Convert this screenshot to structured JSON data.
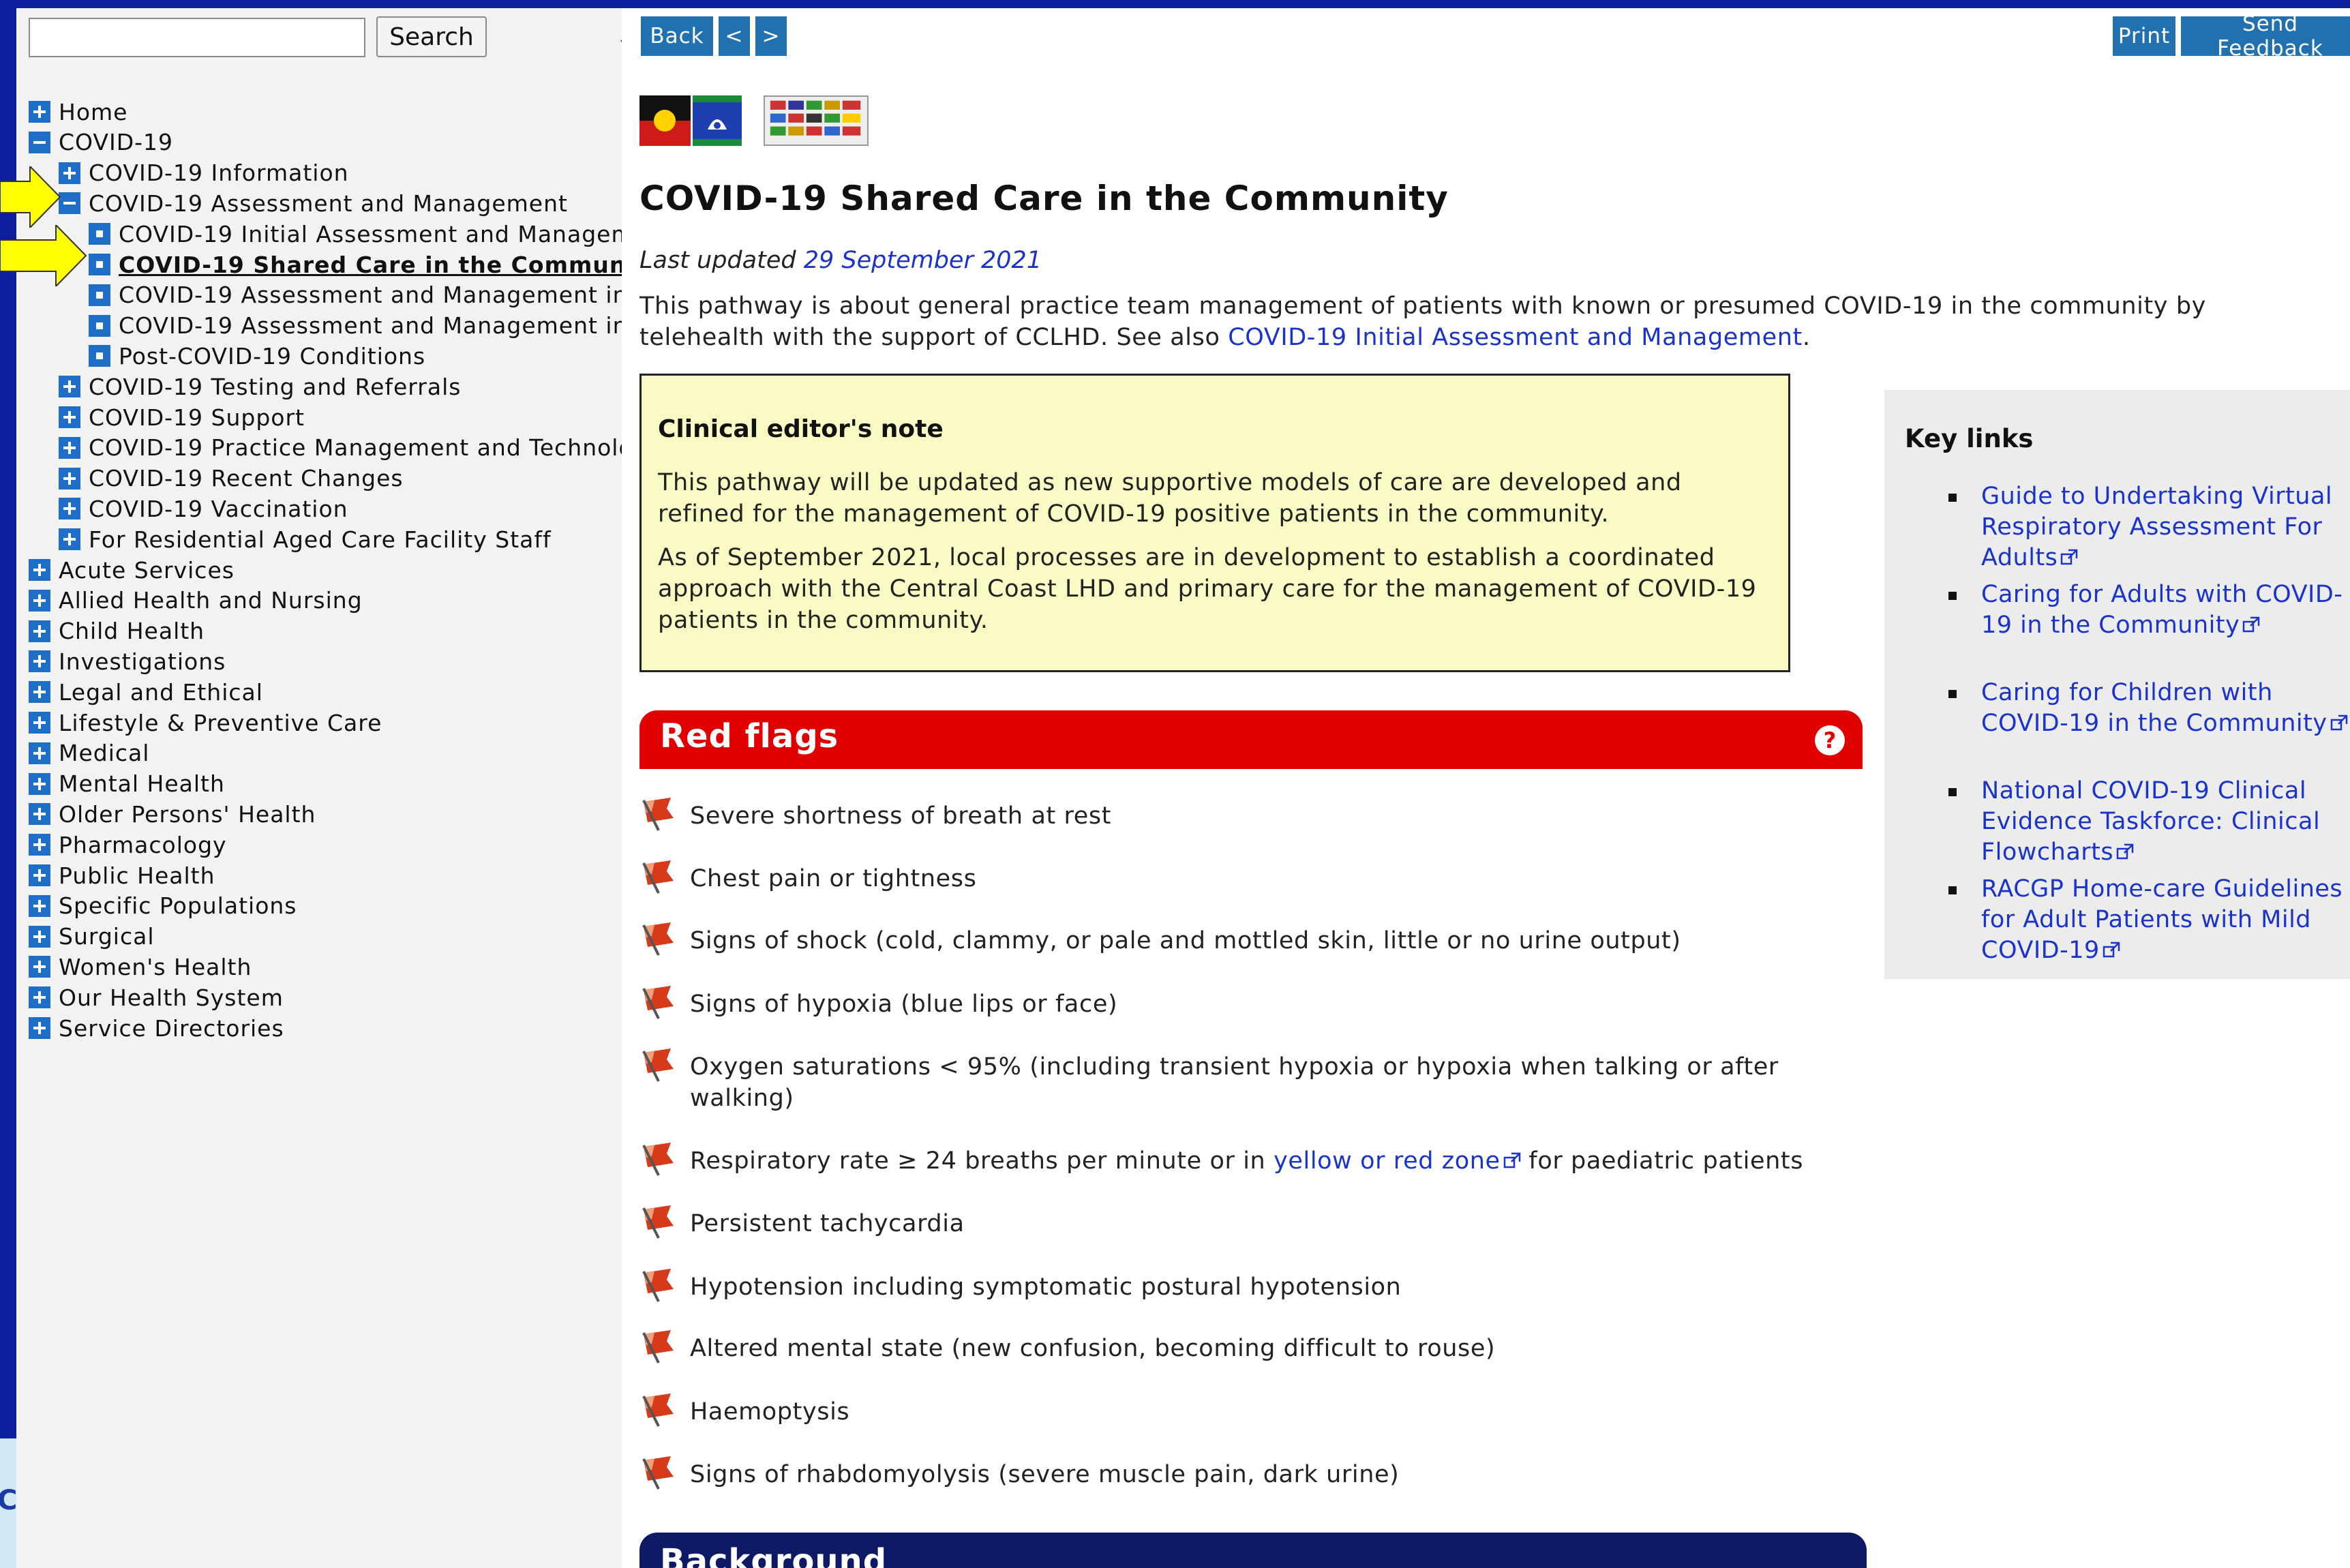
{
  "search": {
    "value": "",
    "button_label": "Search"
  },
  "nav": [
    {
      "label": "Home",
      "icon": "plus"
    },
    {
      "label": "COVID-19",
      "icon": "minus"
    },
    {
      "label": "COVID-19 Information",
      "icon": "plus"
    },
    {
      "label": "COVID-19 Assessment and Management",
      "icon": "minus"
    },
    {
      "label": "COVID-19 Initial Assessment and Managem",
      "icon": "leaf"
    },
    {
      "label": "COVID-19 Shared Care in the Communi",
      "icon": "leaf",
      "current": true
    },
    {
      "label": "COVID-19 Assessment and Management in",
      "icon": "leaf"
    },
    {
      "label": "COVID-19 Assessment and Management in",
      "icon": "leaf"
    },
    {
      "label": "Post-COVID-19 Conditions",
      "icon": "leaf"
    },
    {
      "label": "COVID-19 Testing and Referrals",
      "icon": "plus"
    },
    {
      "label": "COVID-19 Support",
      "icon": "plus"
    },
    {
      "label": "COVID-19 Practice Management and Technolo",
      "icon": "plus"
    },
    {
      "label": "COVID-19 Recent Changes",
      "icon": "plus"
    },
    {
      "label": "COVID-19 Vaccination",
      "icon": "plus"
    },
    {
      "label": "For Residential Aged Care Facility Staff",
      "icon": "plus"
    },
    {
      "label": "Acute Services",
      "icon": "plus"
    },
    {
      "label": "Allied Health and Nursing",
      "icon": "plus"
    },
    {
      "label": "Child Health",
      "icon": "plus"
    },
    {
      "label": "Investigations",
      "icon": "plus"
    },
    {
      "label": "Legal and Ethical",
      "icon": "plus"
    },
    {
      "label": "Lifestyle & Preventive Care",
      "icon": "plus"
    },
    {
      "label": "Medical",
      "icon": "plus"
    },
    {
      "label": "Mental Health",
      "icon": "plus"
    },
    {
      "label": "Older Persons' Health",
      "icon": "plus"
    },
    {
      "label": "Pharmacology",
      "icon": "plus"
    },
    {
      "label": "Public Health",
      "icon": "plus"
    },
    {
      "label": "Specific Populations",
      "icon": "plus"
    },
    {
      "label": "Surgical",
      "icon": "plus"
    },
    {
      "label": "Women's Health",
      "icon": "plus"
    },
    {
      "label": "Our Health System",
      "icon": "plus"
    },
    {
      "label": "Service Directories",
      "icon": "plus"
    }
  ],
  "left_edge_letter": "C",
  "toolbar": {
    "back": "Back",
    "prev": "<",
    "next": ">",
    "print": "Print",
    "feedback": "Send Feedback"
  },
  "page": {
    "title": "COVID-19 Shared Care in the Community",
    "last_updated_label": "Last updated",
    "last_updated_date": "29 September 2021",
    "intro_text": "This pathway is about general practice team management of patients with known or presumed COVID-19 in the community by telehealth with the support of CCLHD. See also ",
    "intro_link": "COVID-19 Initial Assessment and Management",
    "intro_end": "."
  },
  "editor_note": {
    "title": "Clinical editor's note",
    "para1": "This pathway will be updated as new supportive models of care are developed and refined for the management of COVID-19 positive patients in the community.",
    "para2": "As of September 2021, local processes are in development to establish a coordinated approach with the Central Coast LHD and primary care for the management of COVID-19 patients in the community."
  },
  "red_flags": {
    "title": "Red flags",
    "help": "?",
    "items": [
      {
        "text": "Severe shortness of breath at rest"
      },
      {
        "text": "Chest pain or tightness"
      },
      {
        "text": "Signs of shock (cold, clammy, or pale and mottled skin, little or no urine output)"
      },
      {
        "text": "Signs of hypoxia (blue lips or face)"
      },
      {
        "text": "Oxygen saturations < 95% (including transient hypoxia or hypoxia when talking or after walking)"
      },
      {
        "before": "Respiratory rate ≥ 24 breaths per minute or in ",
        "link": "yellow or red zone",
        "after": " for paediatric patients"
      },
      {
        "text": "Persistent tachycardia"
      },
      {
        "text": "Hypotension including symptomatic postural hypotension"
      },
      {
        "text": "Altered mental state (new confusion, becoming difficult to rouse)"
      },
      {
        "text": "Haemoptysis"
      },
      {
        "text": "Signs of rhabdomyolysis (severe muscle pain, dark urine)"
      }
    ]
  },
  "background": {
    "title": "Background"
  },
  "key_links": {
    "title": "Key links",
    "items": [
      "Guide to Undertaking Virtual Respiratory Assessment For Adults",
      "Caring for Adults with COVID-19 in the Community",
      "Caring for Children with COVID-19 in the Community",
      "National COVID-19 Clinical Evidence Taskforce: Clinical Flowcharts",
      "RACGP Home-care Guidelines for Adult Patients with Mild COVID-19"
    ]
  },
  "colors": {
    "frame": "#0c1f9e",
    "nav_icon": "#1f6fc8",
    "button": "#2170b0",
    "link": "#1a33c9",
    "red_flags": "#e00000",
    "background_header": "#0e1a66",
    "note_bg": "#fafac4",
    "arrow": "#ffff00"
  }
}
